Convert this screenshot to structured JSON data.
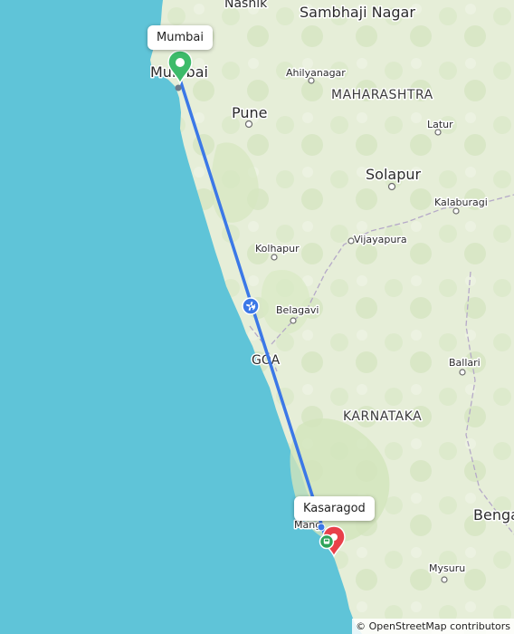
{
  "map": {
    "route": {
      "origin": "Mumbai",
      "destination": "Kasaragod",
      "mode_icon": "airplane-icon",
      "route_color": "#3b78e7",
      "origin_marker_color": "#3dbb6a",
      "destination_marker_color": "#e8404a"
    },
    "labels": {
      "nashik": "Nashik",
      "sambhaji_nagar": "Sambhaji Nagar",
      "ahilyanagar": "Ahilyanagar",
      "maharashtra": "MAHARASHTRA",
      "pune": "Pune",
      "latur": "Latur",
      "solapur": "Solapur",
      "kalaburagi": "Kalaburagi",
      "kolhapur": "Kolhapur",
      "vijayapura": "Vijayapura",
      "belagavi": "Belagavi",
      "goa": "GOA",
      "ballari": "Ballari",
      "karnataka": "KARNATAKA",
      "mangaluru": "Mang",
      "bengaluru": "Benga",
      "mysuru": "Mysuru",
      "mumbai_map": "Mumbai"
    },
    "callouts": {
      "origin": "Mumbai",
      "destination": "Kasaragod"
    },
    "attribution": "© OpenStreetMap contributors",
    "colors": {
      "sea": "#5fc4d8",
      "land": "#e7efd9",
      "land_alt": "#d7e8c4",
      "route": "#3b78e7"
    }
  }
}
